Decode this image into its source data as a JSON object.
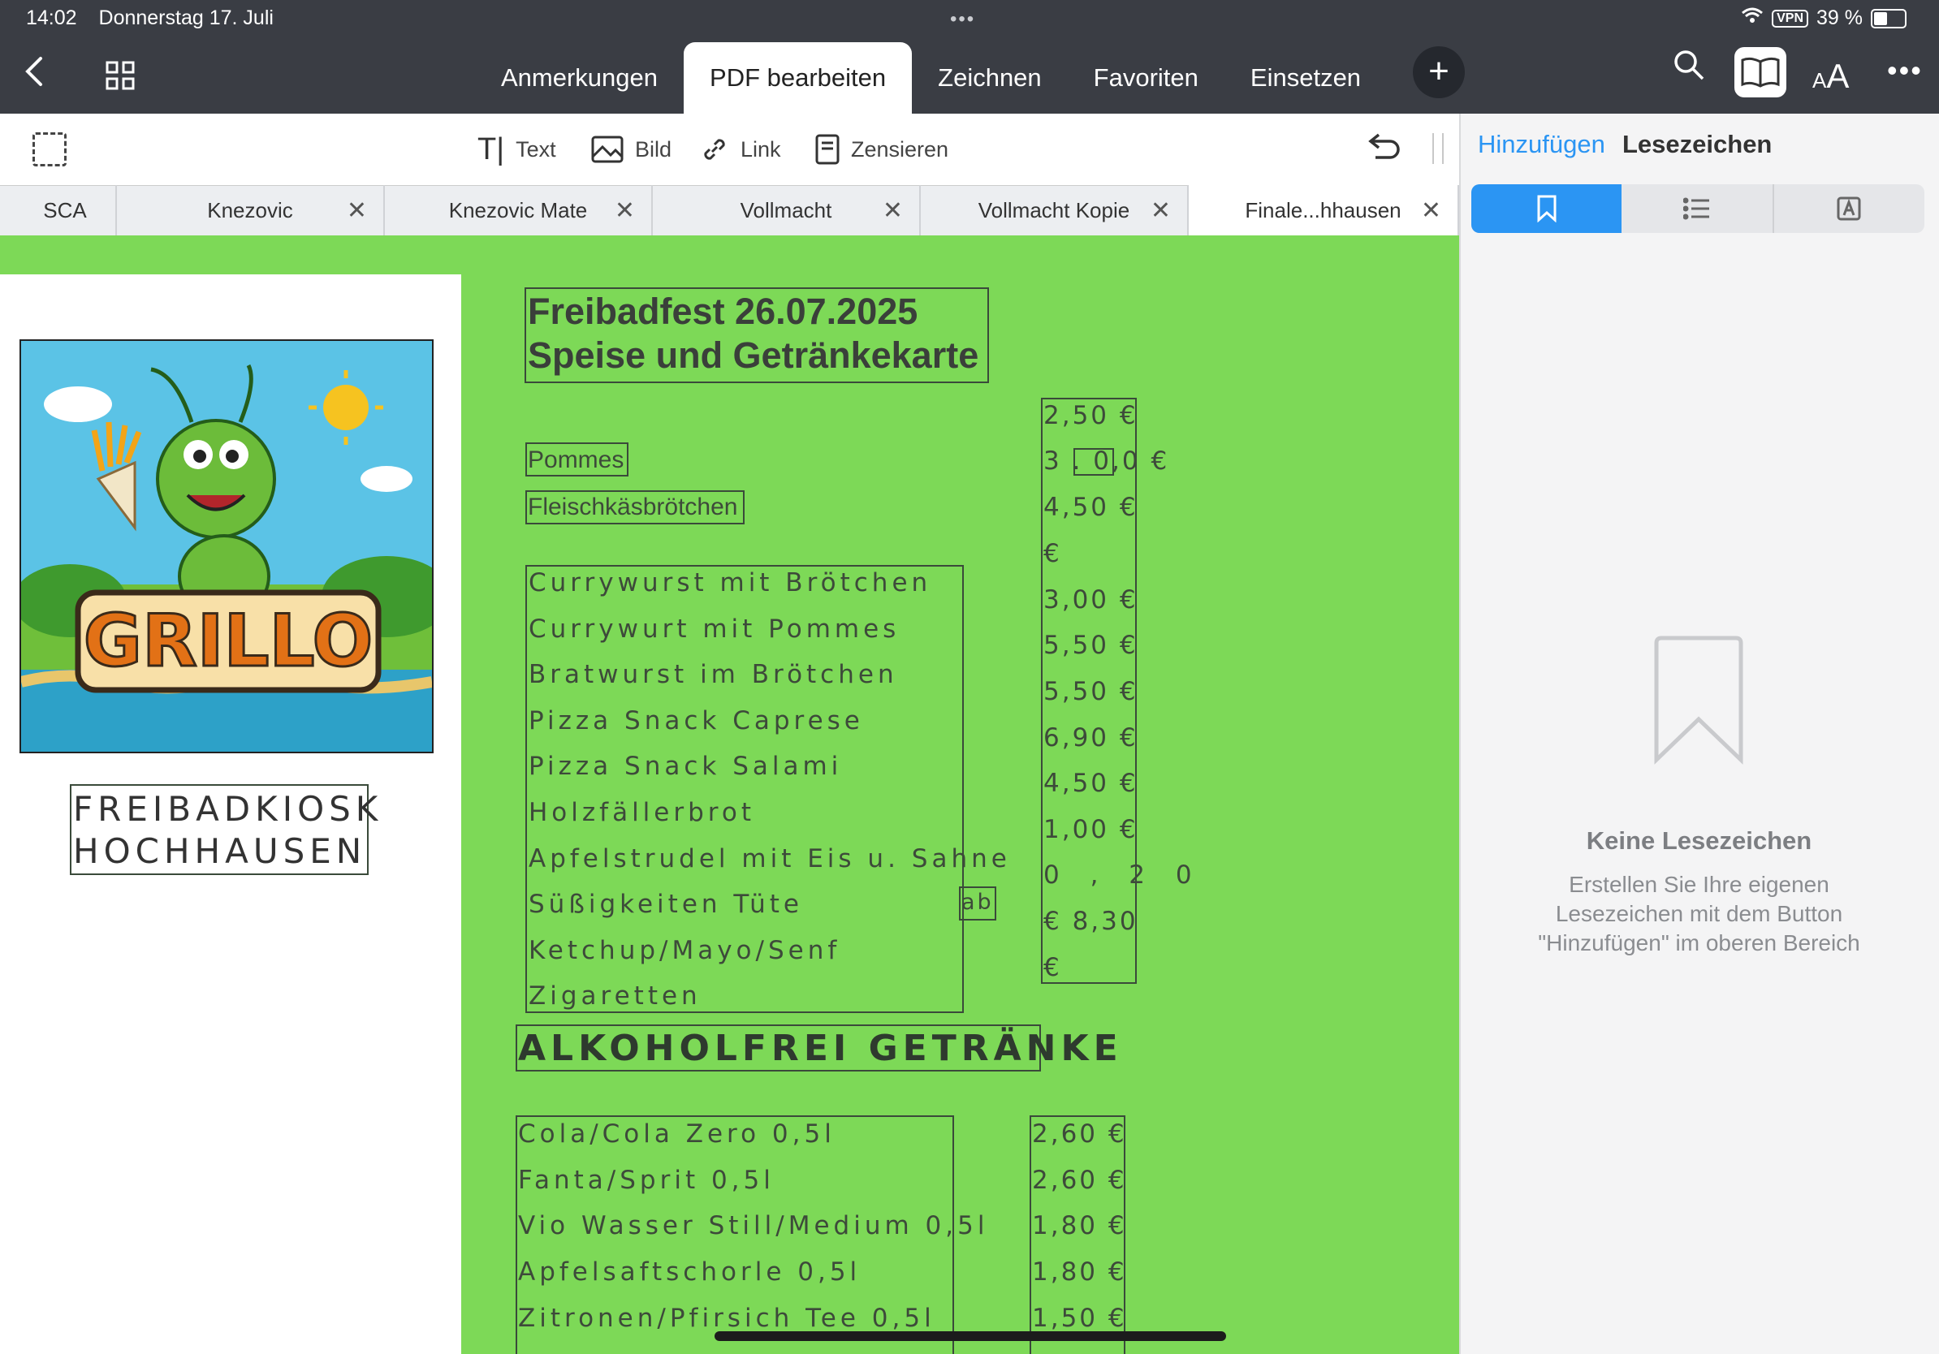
{
  "status": {
    "time": "14:02",
    "date": "Donnerstag 17. Juli",
    "vpn": "VPN",
    "battery": "39 %",
    "battery_level": 0.39
  },
  "tabs": [
    {
      "label": "Anmerkungen"
    },
    {
      "label": "PDF bearbeiten"
    },
    {
      "label": "Zeichnen"
    },
    {
      "label": "Favoriten"
    },
    {
      "label": "Einsetzen"
    }
  ],
  "edit_toolbar": {
    "text": "Text",
    "image": "Bild",
    "link": "Link",
    "redact": "Zensieren"
  },
  "doc_tabs": [
    {
      "label": "SCA"
    },
    {
      "label": "Knezovic"
    },
    {
      "label": "Knezovic Mate"
    },
    {
      "label": "Vollmacht"
    },
    {
      "label": "Vollmacht Kopie"
    },
    {
      "label": "Finale...hhausen"
    }
  ],
  "sidebar": {
    "add": "Hinzufügen",
    "title": "Lesezeichen",
    "empty_title": "Keine Lesezeichen",
    "empty_line1": "Erstellen Sie Ihre eigenen",
    "empty_line2": "Lesezeichen mit dem Button",
    "empty_line3": "\"Hinzufügen\" im oberen Bereich"
  },
  "document": {
    "logo_text": "GRILLO",
    "kiosk_line1": "FREIBADKIOSK",
    "kiosk_line2": "HOCHHAUSEN",
    "title_line1": "Freibadfest 26.07.2025",
    "title_line2": "Speise und Getränkekarte",
    "item_pommes": "Pommes",
    "item_fleisch": "Fleischkäsbrötchen",
    "items": [
      "Currywurst mit Brötchen",
      "Currywurt mit Pommes",
      "Bratwurst im Brötchen",
      "Pizza Snack Caprese",
      "Pizza Snack Salami",
      "Holzfällerbrot",
      "Apfelstrudel mit Eis u. Sahne",
      "Süßigkeiten Tüte",
      "Ketchup/Mayo/Senf",
      "Zigaretten"
    ],
    "ab": "ab",
    "prices": [
      "2,50  €",
      "3 . 0,0 €",
      "4,50  €",
      "€",
      "3,00  €",
      "5,50  €",
      "5,50  €",
      "6,90  €",
      "4,50  €",
      "1,00  €",
      "0 , 2 0",
      "€  8,30",
      "€"
    ],
    "section_title": "ALKOHOLFREI GETRÄNKE",
    "drinks": [
      "Cola/Cola Zero 0,5l",
      "Fanta/Sprit 0,5l",
      "Vio Wasser Still/Medium 0,5l",
      "Apfelsaftschorle 0,5l",
      "Zitronen/Pfirsich Tee 0,5l"
    ],
    "drink_prices": [
      "2,60 €",
      "2,60 €",
      "1,80 €",
      "1,80 €",
      "1,50 €"
    ]
  }
}
